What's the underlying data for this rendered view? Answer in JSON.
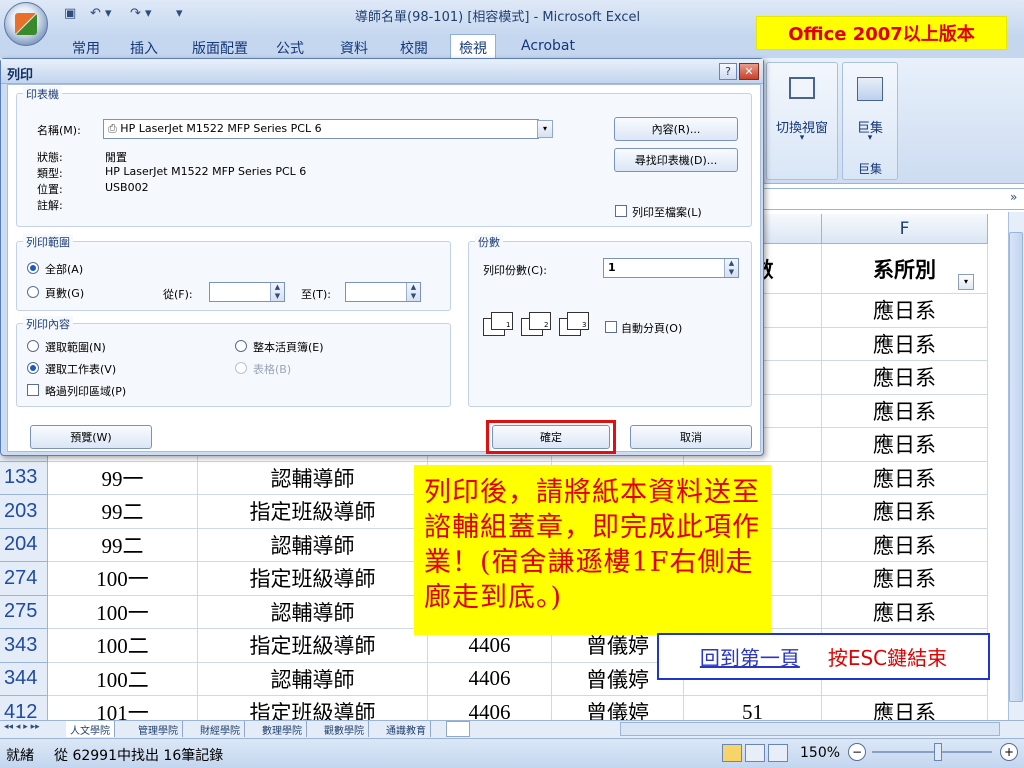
{
  "window": {
    "title": "導師名單(98-101)  [相容模式] - Microsoft Excel"
  },
  "notice_2007": "Office 2007以上版本",
  "ribbon": {
    "tabs": [
      "常用",
      "插入",
      "版面配置",
      "公式",
      "資料",
      "校閱",
      "檢視",
      "Acrobat"
    ],
    "active_tab": "檢視",
    "switch_window": "切換視窗",
    "macros": "巨集",
    "macros_group": "巨集"
  },
  "grid": {
    "column_f": "F",
    "header_count": "人數",
    "header_dept": "系所別",
    "rows": [
      {
        "row": "",
        "year": "",
        "type": "",
        "room": "",
        "name": "",
        "count": "",
        "dept": "應日系"
      },
      {
        "row": "",
        "year": "",
        "type": "",
        "room": "",
        "name": "",
        "count": "",
        "dept": "應日系"
      },
      {
        "row": "",
        "year": "",
        "type": "",
        "room": "",
        "name": "",
        "count": "",
        "dept": "應日系"
      },
      {
        "row": "",
        "year": "",
        "type": "",
        "room": "",
        "name": "",
        "count": "",
        "dept": "應日系"
      },
      {
        "row": "1",
        "year": "",
        "type": "",
        "room": "",
        "name": "",
        "count": "",
        "dept": "應日系"
      },
      {
        "row": "133",
        "year": "99一",
        "type": "認輔導師",
        "room": "",
        "name": "",
        "count": "",
        "dept": "應日系"
      },
      {
        "row": "203",
        "year": "99二",
        "type": "指定班級導師",
        "room": "",
        "name": "",
        "count": "",
        "dept": "應日系"
      },
      {
        "row": "204",
        "year": "99二",
        "type": "認輔導師",
        "room": "",
        "name": "",
        "count": "",
        "dept": "應日系"
      },
      {
        "row": "274",
        "year": "100一",
        "type": "指定班級導師",
        "room": "",
        "name": "",
        "count": "",
        "dept": "應日系"
      },
      {
        "row": "275",
        "year": "100一",
        "type": "認輔導師",
        "room": "",
        "name": "",
        "count": "",
        "dept": "應日系"
      },
      {
        "row": "343",
        "year": "100二",
        "type": "指定班級導師",
        "room": "4406",
        "name": "曾儀婷",
        "count": "",
        "dept": ""
      },
      {
        "row": "344",
        "year": "100二",
        "type": "認輔導師",
        "room": "4406",
        "name": "曾儀婷",
        "count": "",
        "dept": ""
      },
      {
        "row": "412",
        "year": "101一",
        "type": "指定班級導師",
        "room": "4406",
        "name": "曾儀婷",
        "count": "51",
        "dept": "應日系"
      }
    ]
  },
  "sheet_tabs": [
    "人文學院",
    "管理學院",
    "財經學院",
    "數理學院",
    "觀數學院",
    "通識教育"
  ],
  "status": {
    "ready": "就緒",
    "found": "從 62991中找出 16筆記錄",
    "zoom": "150%"
  },
  "dialog": {
    "title": "列印",
    "printer_group": "印表機",
    "name_label": "名稱(M):",
    "printer_name": "HP LaserJet M1522 MFP Series PCL 6",
    "status_label": "狀態:",
    "status_value": "閒置",
    "type_label": "類型:",
    "type_value": "HP LaserJet M1522 MFP Series PCL 6",
    "where_label": "位置:",
    "where_value": "USB002",
    "comment_label": "註解:",
    "properties_btn": "內容(R)...",
    "find_printer_btn": "尋找印表機(D)...",
    "print_to_file": "列印至檔案(L)",
    "range_group": "列印範圍",
    "all": "全部(A)",
    "pages": "頁數(G)",
    "from": "從(F):",
    "to": "至(T):",
    "what_group": "列印內容",
    "selection": "選取範圍(N)",
    "active_sheets": "選取工作表(V)",
    "entire_workbook": "整本活頁簿(E)",
    "table": "表格(B)",
    "ignore_print_areas": "略過列印區域(P)",
    "copies_group": "份數",
    "num_copies_label": "列印份數(C):",
    "num_copies": "1",
    "collate": "自動分頁(O)",
    "preview_btn": "預覽(W)",
    "ok_btn": "確定",
    "cancel_btn": "取消"
  },
  "note": "列印後，請將紙本資料送至諮輔組蓋章，即完成此項作業！(宿舍謙遜樓1F右側走廊走到底。)",
  "nav": {
    "back_link": "回到第一頁",
    "esc_text": "按ESC鍵結束"
  }
}
